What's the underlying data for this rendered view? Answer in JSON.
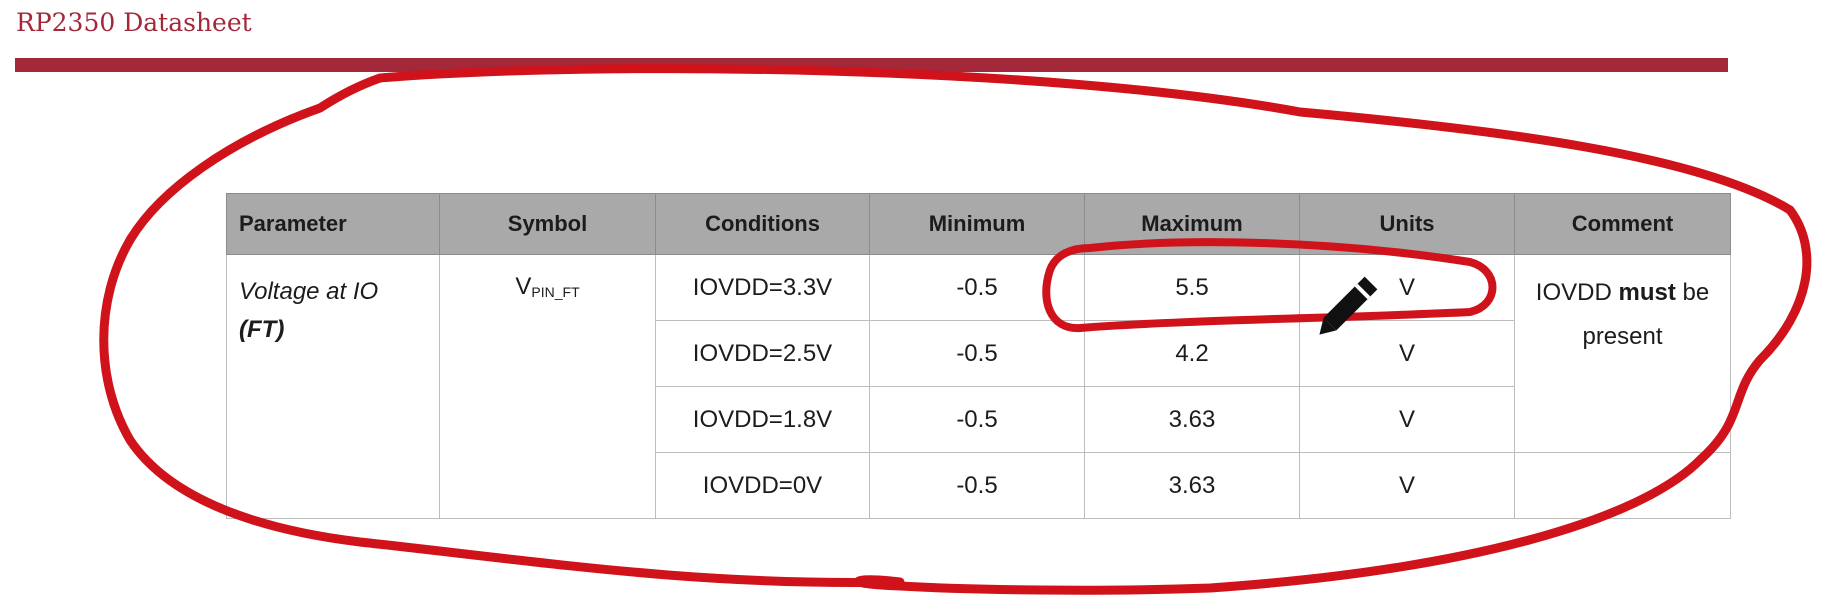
{
  "header": {
    "title": "RP2350 Datasheet",
    "accent_color": "#a3283a"
  },
  "table": {
    "columns": [
      "Parameter",
      "Symbol",
      "Conditions",
      "Minimum",
      "Maximum",
      "Units",
      "Comment"
    ],
    "parameter": {
      "name": "Voltage at IO",
      "qualifier": "(FT)"
    },
    "symbol": {
      "base": "V",
      "subscript": "PIN_FT"
    },
    "rows": [
      {
        "conditions": "IOVDD=3.3V",
        "minimum": "-0.5",
        "maximum": "5.5",
        "units": "V"
      },
      {
        "conditions": "IOVDD=2.5V",
        "minimum": "-0.5",
        "maximum": "4.2",
        "units": "V"
      },
      {
        "conditions": "IOVDD=1.8V",
        "minimum": "-0.5",
        "maximum": "3.63",
        "units": "V"
      },
      {
        "conditions": "IOVDD=0V",
        "minimum": "-0.5",
        "maximum": "3.63",
        "units": "V"
      }
    ],
    "comment": {
      "before": "IOVDD ",
      "emphasis": "must",
      "after": " be present"
    }
  },
  "annotation": {
    "ink_color": "#d0121b",
    "pen_cursor_icon": "pencil-icon"
  }
}
